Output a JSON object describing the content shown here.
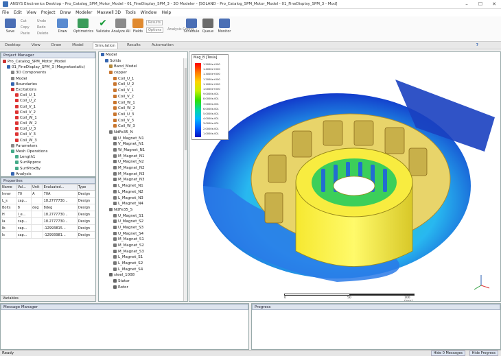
{
  "window": {
    "title": "ANSYS Electronics Desktop - Pro_Catalog_SPM_Motor_Model - 01_FineDisplay_SPM_3 - 3D Modeler - [SOLAND - Pro_Catalog_SPM_Motor_Model - 01_FineDisplay_SPM_3 - Mod]"
  },
  "menu": [
    "File",
    "Edit",
    "View",
    "Project",
    "Draw",
    "Modeler",
    "Maxwell 3D",
    "Tools",
    "Window",
    "Help"
  ],
  "toolbar": {
    "save": "Save",
    "cut": "Cut",
    "copy": "Copy",
    "paste": "Paste",
    "undo": "Undo",
    "redo": "Redo",
    "delete": "Delete",
    "draw": "Draw",
    "optimetrics": "Optimetrics",
    "validate": "Validate",
    "analyze_all": "Analyze All",
    "fields": "Fields",
    "results": "Results",
    "options": "Options",
    "analysis_config": "Analysis Config",
    "schedule": "Schedule",
    "queue": "Queue",
    "monitor": "Monitor"
  },
  "ribbon_tabs": [
    "Desktop",
    "View",
    "Draw",
    "Model",
    "Simulation",
    "Results",
    "Automation"
  ],
  "ribbon_active": "Simulation",
  "project_manager": {
    "title": "Project Manager",
    "items": [
      {
        "depth": 0,
        "label": "Pro_Catalog_SPM_Motor_Model",
        "c": "#c33"
      },
      {
        "depth": 1,
        "label": "01_FineDisplay_SPM_3 (Magnetostatic)",
        "c": "#3465b0"
      },
      {
        "depth": 2,
        "label": "3D Components",
        "c": "#888"
      },
      {
        "depth": 2,
        "label": "Model",
        "c": "#888"
      },
      {
        "depth": 2,
        "label": "Boundaries",
        "c": "#3465b0"
      },
      {
        "depth": 2,
        "label": "Excitations",
        "c": "#c33"
      },
      {
        "depth": 3,
        "label": "Coil_U_1",
        "c": "#d33"
      },
      {
        "depth": 3,
        "label": "Coil_U_2",
        "c": "#d33"
      },
      {
        "depth": 3,
        "label": "Coil_V_1",
        "c": "#d33"
      },
      {
        "depth": 3,
        "label": "Coil_V_2",
        "c": "#d33"
      },
      {
        "depth": 3,
        "label": "Coil_W_1",
        "c": "#d33"
      },
      {
        "depth": 3,
        "label": "Coil_W_2",
        "c": "#d33"
      },
      {
        "depth": 3,
        "label": "Coil_U_3",
        "c": "#d33"
      },
      {
        "depth": 3,
        "label": "Coil_V_3",
        "c": "#d33"
      },
      {
        "depth": 3,
        "label": "Coil_W_3",
        "c": "#d33"
      },
      {
        "depth": 2,
        "label": "Parameters",
        "c": "#888"
      },
      {
        "depth": 2,
        "label": "Mesh Operations",
        "c": "#4a8"
      },
      {
        "depth": 3,
        "label": "Length1",
        "c": "#4a8"
      },
      {
        "depth": 3,
        "label": "SurfApprox",
        "c": "#4a8"
      },
      {
        "depth": 3,
        "label": "SurfProxBy",
        "c": "#4a8"
      },
      {
        "depth": 2,
        "label": "Analysis",
        "c": "#3465b0"
      }
    ]
  },
  "properties": {
    "title": "Properties",
    "headers": [
      "Name",
      "Val...",
      "Unit",
      "Evaluated...",
      "Type"
    ],
    "rows": [
      [
        "Inner",
        "70",
        "A",
        "70A",
        "Design"
      ],
      [
        "L_s",
        "cap...",
        "",
        "18.2777730...",
        "Design"
      ],
      [
        "Bolts",
        "8",
        "deg",
        "8deg",
        "Design"
      ],
      [
        "H",
        "l_e...",
        "",
        "18.2777730...",
        "Design"
      ],
      [
        "Ia",
        "cap...",
        "",
        "18.2777730...",
        "Design"
      ],
      [
        "Ib",
        "cap...",
        "",
        "-12993815...",
        "Design"
      ],
      [
        "Ic",
        "cap...",
        "",
        "-12993981...",
        "Design"
      ]
    ],
    "footer_tabs": "Variables"
  },
  "model_tree": {
    "root": "Model",
    "items": [
      {
        "depth": 1,
        "label": "Solids",
        "c": "#3465b0"
      },
      {
        "depth": 2,
        "label": "Band_Model",
        "c": "#b58a3c"
      },
      {
        "depth": 2,
        "label": "copper",
        "c": "#c9762f"
      },
      {
        "depth": 3,
        "label": "Coil_U_1",
        "c": "#c9762f"
      },
      {
        "depth": 3,
        "label": "Coil_U_2",
        "c": "#c9762f"
      },
      {
        "depth": 3,
        "label": "Coil_V_1",
        "c": "#c9762f"
      },
      {
        "depth": 3,
        "label": "Coil_V_2",
        "c": "#c9762f"
      },
      {
        "depth": 3,
        "label": "Coil_W_1",
        "c": "#c9762f"
      },
      {
        "depth": 3,
        "label": "Coil_W_2",
        "c": "#c9762f"
      },
      {
        "depth": 3,
        "label": "Coil_U_3",
        "c": "#c9762f"
      },
      {
        "depth": 3,
        "label": "Coil_V_3",
        "c": "#c9762f"
      },
      {
        "depth": 3,
        "label": "Coil_W_3",
        "c": "#c9762f"
      },
      {
        "depth": 2,
        "label": "NdFe35_N",
        "c": "#777"
      },
      {
        "depth": 3,
        "label": "U_Magnet_N1",
        "c": "#777"
      },
      {
        "depth": 3,
        "label": "V_Magnet_N1",
        "c": "#777"
      },
      {
        "depth": 3,
        "label": "W_Magnet_N1",
        "c": "#777"
      },
      {
        "depth": 3,
        "label": "M_Magnet_N1",
        "c": "#777"
      },
      {
        "depth": 3,
        "label": "U_Magnet_N2",
        "c": "#777"
      },
      {
        "depth": 3,
        "label": "M_Magnet_N2",
        "c": "#777"
      },
      {
        "depth": 3,
        "label": "M_Magnet_N3",
        "c": "#777"
      },
      {
        "depth": 3,
        "label": "M_Magnet_N3",
        "c": "#777"
      },
      {
        "depth": 3,
        "label": "L_Magnet_N1",
        "c": "#777"
      },
      {
        "depth": 3,
        "label": "L_Magnet_N2",
        "c": "#777"
      },
      {
        "depth": 3,
        "label": "L_Magnet_N3",
        "c": "#777"
      },
      {
        "depth": 3,
        "label": "L_Magnet_N4",
        "c": "#777"
      },
      {
        "depth": 2,
        "label": "NdFe35_S",
        "c": "#777"
      },
      {
        "depth": 3,
        "label": "U_Magnet_S1",
        "c": "#777"
      },
      {
        "depth": 3,
        "label": "U_Magnet_S2",
        "c": "#777"
      },
      {
        "depth": 3,
        "label": "U_Magnet_S3",
        "c": "#777"
      },
      {
        "depth": 3,
        "label": "U_Magnet_S4",
        "c": "#777"
      },
      {
        "depth": 3,
        "label": "M_Magnet_S1",
        "c": "#777"
      },
      {
        "depth": 3,
        "label": "M_Magnet_S2",
        "c": "#777"
      },
      {
        "depth": 3,
        "label": "M_Magnet_S3",
        "c": "#777"
      },
      {
        "depth": 3,
        "label": "L_Magnet_S1",
        "c": "#777"
      },
      {
        "depth": 3,
        "label": "L_Magnet_S2",
        "c": "#777"
      },
      {
        "depth": 3,
        "label": "L_Magnet_S4",
        "c": "#777"
      },
      {
        "depth": 2,
        "label": "steel_1008",
        "c": "#666"
      },
      {
        "depth": 3,
        "label": "Stator",
        "c": "#666"
      },
      {
        "depth": 3,
        "label": "Rotor",
        "c": "#666"
      }
    ]
  },
  "legend": {
    "title": "Mag_B [Tesla]",
    "values": [
      "1.5000e+000",
      "1.4000e+000",
      "1.3000e+000",
      "1.2000e+000",
      "1.1000e+000",
      "1.0000e+000",
      "9.0000e-001",
      "8.0000e-001",
      "7.0000e-001",
      "6.0000e-001",
      "5.0000e-001",
      "4.0000e-001",
      "3.0000e-001",
      "2.0000e-001",
      "1.0000e-001"
    ]
  },
  "scale": {
    "start": "0",
    "mid": "50",
    "end": "100 (mm)"
  },
  "message_manager": {
    "title": "Message Manager"
  },
  "progress": {
    "title": "Progress"
  },
  "status": {
    "text": "Ready",
    "messages": "Hide 0 Messages",
    "progress": "Hide Progress"
  },
  "colors": {
    "accent": "#3465b0",
    "panel_header": "#dde4ee"
  }
}
